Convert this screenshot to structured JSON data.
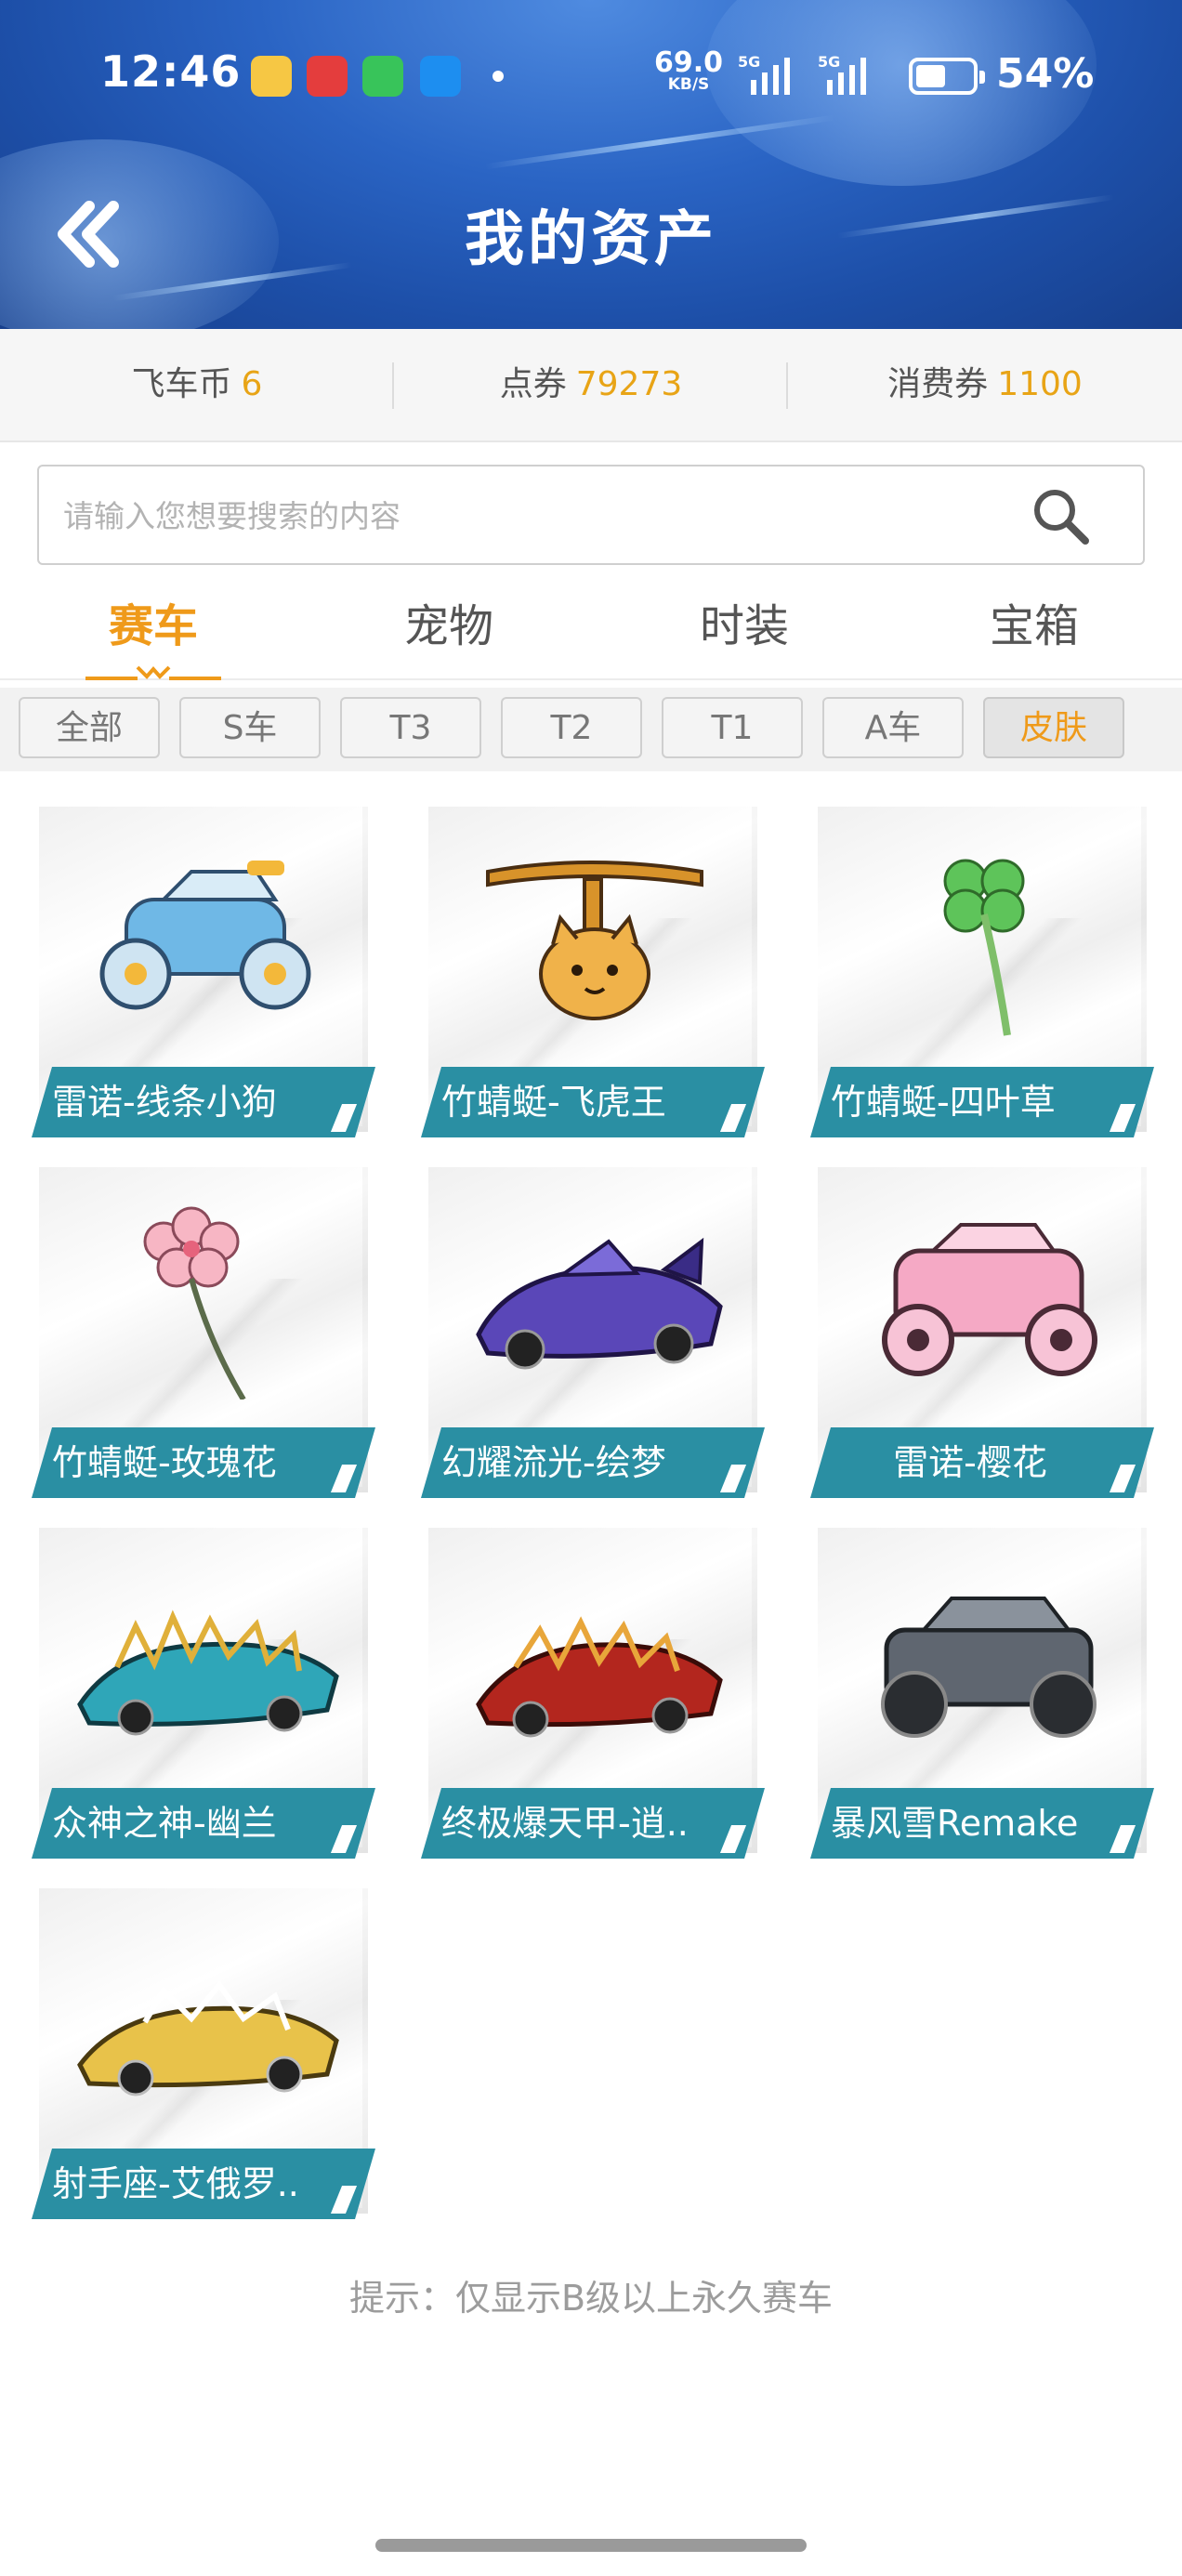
{
  "status_bar": {
    "time": "12:46",
    "net_speed": "69.0",
    "net_unit": "KB/S",
    "signal_1": "5G",
    "signal_2": "5G",
    "battery": "54%",
    "battery_level": 0.54
  },
  "header": {
    "title": "我的资产"
  },
  "currencies": [
    {
      "label": "飞车币",
      "value": "6"
    },
    {
      "label": "点券",
      "value": "79273"
    },
    {
      "label": "消费券",
      "value": "1100"
    }
  ],
  "search": {
    "placeholder": "请输入您想要搜索的内容"
  },
  "tabs": [
    {
      "label": "赛车",
      "active": true
    },
    {
      "label": "宠物",
      "active": false
    },
    {
      "label": "时装",
      "active": false
    },
    {
      "label": "宝箱",
      "active": false
    }
  ],
  "filters": [
    {
      "label": "全部",
      "active": false
    },
    {
      "label": "S车",
      "active": false
    },
    {
      "label": "T3",
      "active": false
    },
    {
      "label": "T2",
      "active": false
    },
    {
      "label": "T1",
      "active": false
    },
    {
      "label": "A车",
      "active": false
    },
    {
      "label": "皮肤",
      "active": true
    }
  ],
  "items": [
    {
      "name": "雷诺-线条小狗",
      "art": "car-blue-icon"
    },
    {
      "name": "竹蜻蜓-飞虎王",
      "art": "tiger-propeller-icon"
    },
    {
      "name": "竹蜻蜓-四叶草",
      "art": "clover-propeller-icon"
    },
    {
      "name": "竹蜻蜓-玫瑰花",
      "art": "flower-propeller-icon"
    },
    {
      "name": "幻耀流光-绘梦",
      "art": "car-purple-icon"
    },
    {
      "name": "雷诺-樱花",
      "art": "car-pink-icon"
    },
    {
      "name": "众神之神-幽兰",
      "art": "car-teal-icon"
    },
    {
      "name": "终极爆天甲-逍..",
      "art": "car-red-icon"
    },
    {
      "name": "暴风雪Remake",
      "art": "car-gray-icon"
    },
    {
      "name": "射手座-艾俄罗..",
      "art": "car-gold-icon"
    }
  ],
  "hint": "提示：仅显示B级以上永久赛车",
  "colors": {
    "accent": "#ef9a1a",
    "label_bg": "#2a8fa3",
    "header_blue": "#2a64c4"
  }
}
